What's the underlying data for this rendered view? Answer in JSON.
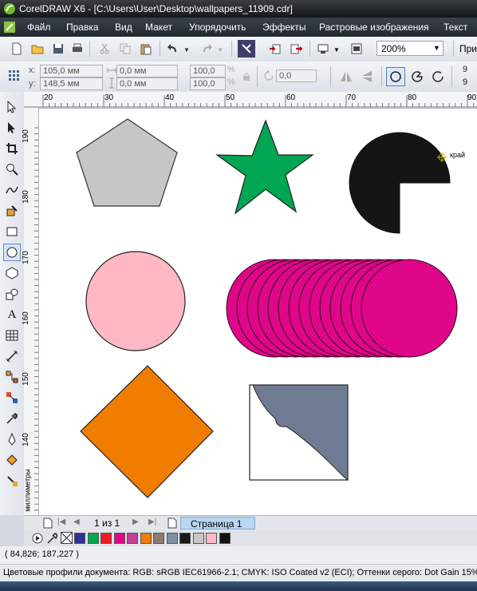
{
  "title_bar": {
    "app": "CorelDRAW X6",
    "document_path": "[C:\\Users\\User\\Desktop\\wallpapers_11909.cdr]"
  },
  "menu": [
    "Файл",
    "Правка",
    "Вид",
    "Макет",
    "Упорядочить",
    "Эффекты",
    "Растровые изображения",
    "Текст"
  ],
  "standard_toolbar": {
    "zoom": "200%",
    "trailing_label": "При"
  },
  "property_bar": {
    "x_label": "x:",
    "x_value": "105,0 мм",
    "y_label": "y:",
    "y_value": "148,5 мм",
    "width_value": "0,0 мм",
    "height_value": "0,0 мм",
    "scale_x": "100,0",
    "scale_y": "100,0",
    "percent": "%",
    "angle_value": "0,0",
    "trailing_top": "9",
    "trailing_bottom": "9"
  },
  "rulers": {
    "horizontal_ticks": [
      "20",
      "30",
      "40",
      "50",
      "60",
      "70",
      "80",
      "90"
    ],
    "vertical_ticks": [
      "190",
      "180",
      "170",
      "160",
      "150",
      "140"
    ],
    "vertical_unit": "миллиметры"
  },
  "canvas": {
    "cursor_label": "край",
    "shapes": [
      {
        "name": "pentagon",
        "fill": "#c6c6c6"
      },
      {
        "name": "star",
        "fill": "#00a651"
      },
      {
        "name": "pie",
        "fill": "#151515"
      },
      {
        "name": "circle",
        "fill": "#ffb8c4"
      },
      {
        "name": "blend-cylinder",
        "fill": "#e0068a"
      },
      {
        "name": "diamond",
        "fill": "#f07d00"
      },
      {
        "name": "trimmed-square",
        "fill": "#6e7b92"
      }
    ]
  },
  "page_nav": {
    "counter": "1 из 1",
    "page_tab": "Страница 1"
  },
  "palette": [
    "#2e3192",
    "#00a651",
    "#ed1c24",
    "#e0068a",
    "#c0429a",
    "#f07d00",
    "#8b7c73",
    "#7e8fa6",
    "#1a1a1a",
    "#c8c8c8",
    "#ffb8c4",
    "#111111"
  ],
  "status": {
    "coordinates": "( 84,826; 187,227 )",
    "color_profiles": "Цветовые профили документа: RGB: sRGB IEC61966-2.1; CMYK: ISO Coated v2 (ECI); Оттенки серого: Dot Gain 15%"
  }
}
